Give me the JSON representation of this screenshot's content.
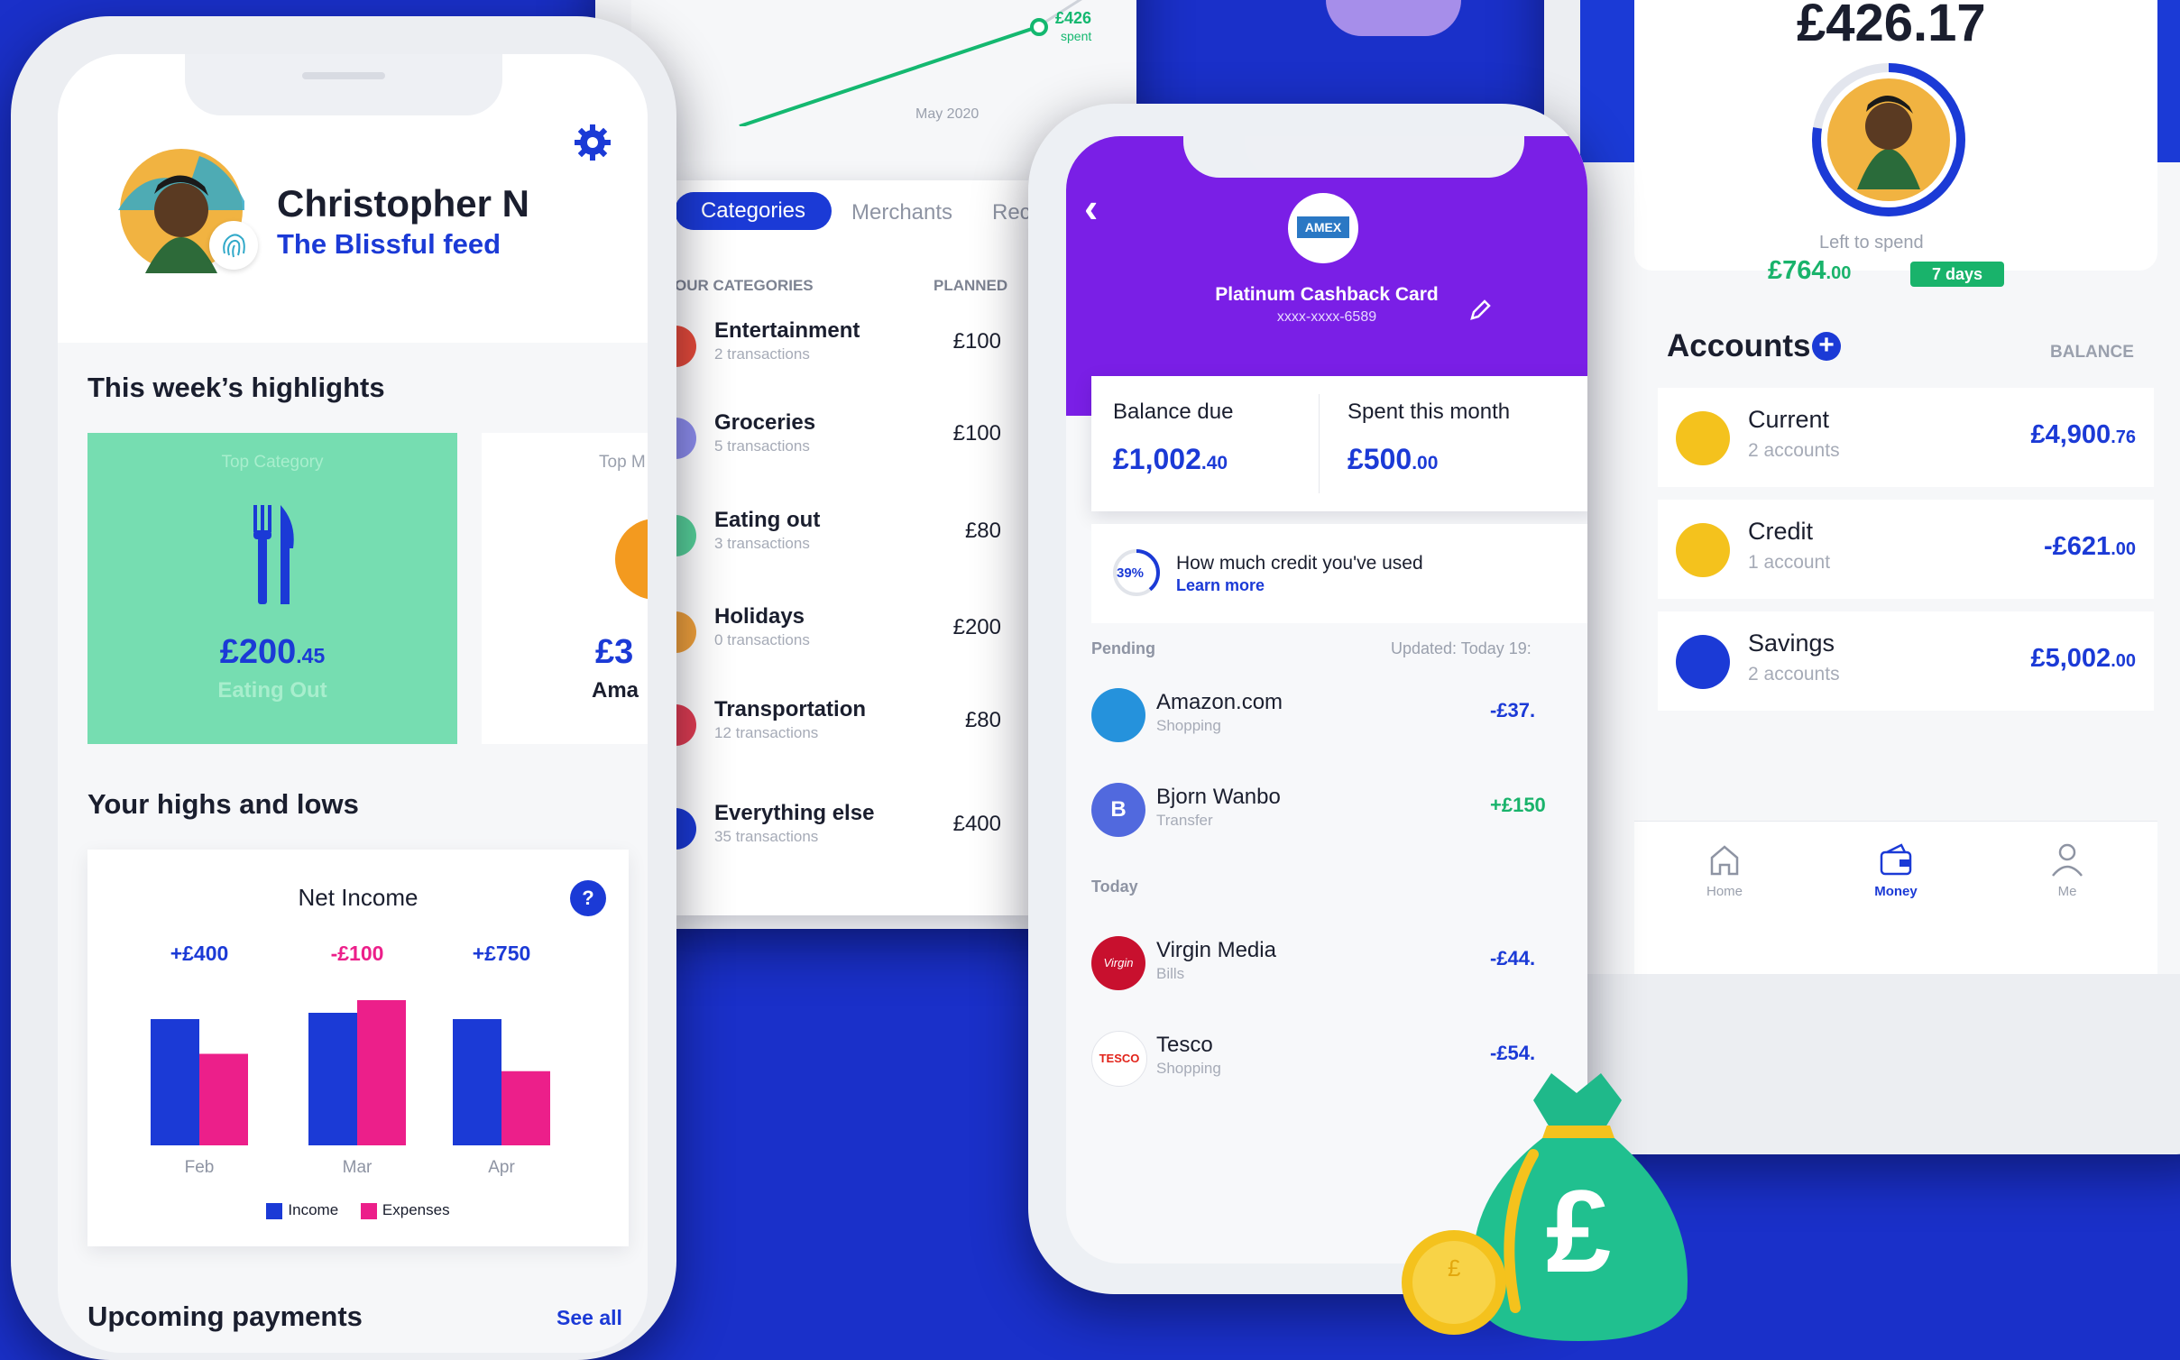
{
  "colors": {
    "bg": "#1a30c9",
    "brand_blue": "#1b3ad6",
    "magenta": "#ec1f8a",
    "mint": "#76ddb1",
    "purple": "#7a1fe6",
    "green": "#19b36b"
  },
  "phone1": {
    "user_name": "Christopher N",
    "feed_title": "The Blissful feed",
    "highlights_heading": "This week’s highlights",
    "card1": {
      "label": "Top Category",
      "amount_main": "£200",
      "amount_dec": ".45",
      "caption": "Eating Out"
    },
    "card2": {
      "label": "Top M",
      "amount": "£3",
      "caption": "Ama"
    },
    "highs_heading": "Your highs and lows",
    "net_income_title": "Net Income",
    "help": "?",
    "upcoming_heading": "Upcoming payments",
    "see_all": "See all",
    "legend_income": "Income",
    "legend_expenses": "Expenses"
  },
  "chart_data": {
    "type": "bar",
    "title": "Net Income",
    "categories": [
      "Feb",
      "Mar",
      "Apr"
    ],
    "series": [
      {
        "name": "Income",
        "values": [
          400,
          420,
          400
        ]
      },
      {
        "name": "Expenses",
        "values": [
          290,
          460,
          235
        ]
      }
    ],
    "data_labels": [
      "+£400",
      "-£100",
      "+£750"
    ],
    "ylim": [
      0,
      500
    ]
  },
  "phone2": {
    "spent_amount": "£426",
    "spent_label": "spent",
    "month_label": "May 2020",
    "tabs": [
      "Categories",
      "Merchants",
      "Rec"
    ],
    "col_left": "OUR CATEGORIES",
    "col_right": "PLANNED",
    "categories": [
      {
        "name": "Entertainment",
        "sub": "2 transactions",
        "planned": "£100",
        "color": "#e84b3a"
      },
      {
        "name": "Groceries",
        "sub": "5 transactions",
        "planned": "£100",
        "color": "#8f8ff0"
      },
      {
        "name": "Eating out",
        "sub": "3 transactions",
        "planned": "£80",
        "color": "#57d39a"
      },
      {
        "name": "Holidays",
        "sub": "0 transactions",
        "planned": "£200",
        "color": "#f2a23b"
      },
      {
        "name": "Transportation",
        "sub": "12 transactions",
        "planned": "£80",
        "color": "#e23d52"
      },
      {
        "name": "Everything else",
        "sub": "35 transactions",
        "planned": "£400",
        "color": "#1b3ad6"
      }
    ]
  },
  "phone3": {
    "back": "‹",
    "card_logo": "AMEX",
    "card_name": "Platinum Cashback Card",
    "card_number": "xxxx-xxxx-6589",
    "balance_due_label": "Balance due",
    "balance_due_main": "£1,002",
    "balance_due_dec": ".40",
    "spent_label": "Spent this month",
    "spent_main": "£500",
    "spent_dec": ".00",
    "credit_pct": "39%",
    "credit_title": "How much credit you've used",
    "learn_more": "Learn more",
    "pending_label": "Pending",
    "updated_label": "Updated: Today 19:",
    "today_label": "Today",
    "transactions": [
      {
        "name": "Amazon.com",
        "sub": "Shopping",
        "amount": "-£37.",
        "badge": ""
      },
      {
        "name": "Bjorn Wanbo",
        "sub": "Transfer",
        "amount": "+£150",
        "badge": "B"
      },
      {
        "name": "Virgin Media",
        "sub": "Bills",
        "amount": "-£44.",
        "badge": "Virgin"
      },
      {
        "name": "Tesco",
        "sub": "Shopping",
        "amount": "-£54.",
        "badge": "TESCO"
      }
    ]
  },
  "phone4": {
    "top_amount": "£426.17",
    "left_to_spend_label": "Left to spend",
    "left_to_spend_main": "£764",
    "left_to_spend_dec": ".00",
    "days_badge": "7 days",
    "accounts_heading": "Accounts",
    "balance_col": "BALANCE",
    "accounts": [
      {
        "name": "Current",
        "sub": "2 accounts",
        "amount_main": "£4,900",
        "amount_dec": ".76"
      },
      {
        "name": "Credit",
        "sub": "1 account",
        "amount_main": "-£621",
        "amount_dec": ".00"
      },
      {
        "name": "Savings",
        "sub": "2 accounts",
        "amount_main": "£5,002",
        "amount_dec": ".00"
      }
    ],
    "nav": [
      {
        "label": "Home"
      },
      {
        "label": "Money"
      },
      {
        "label": "Me"
      }
    ]
  },
  "moneybag_symbol": "£",
  "coin_symbol": "£"
}
